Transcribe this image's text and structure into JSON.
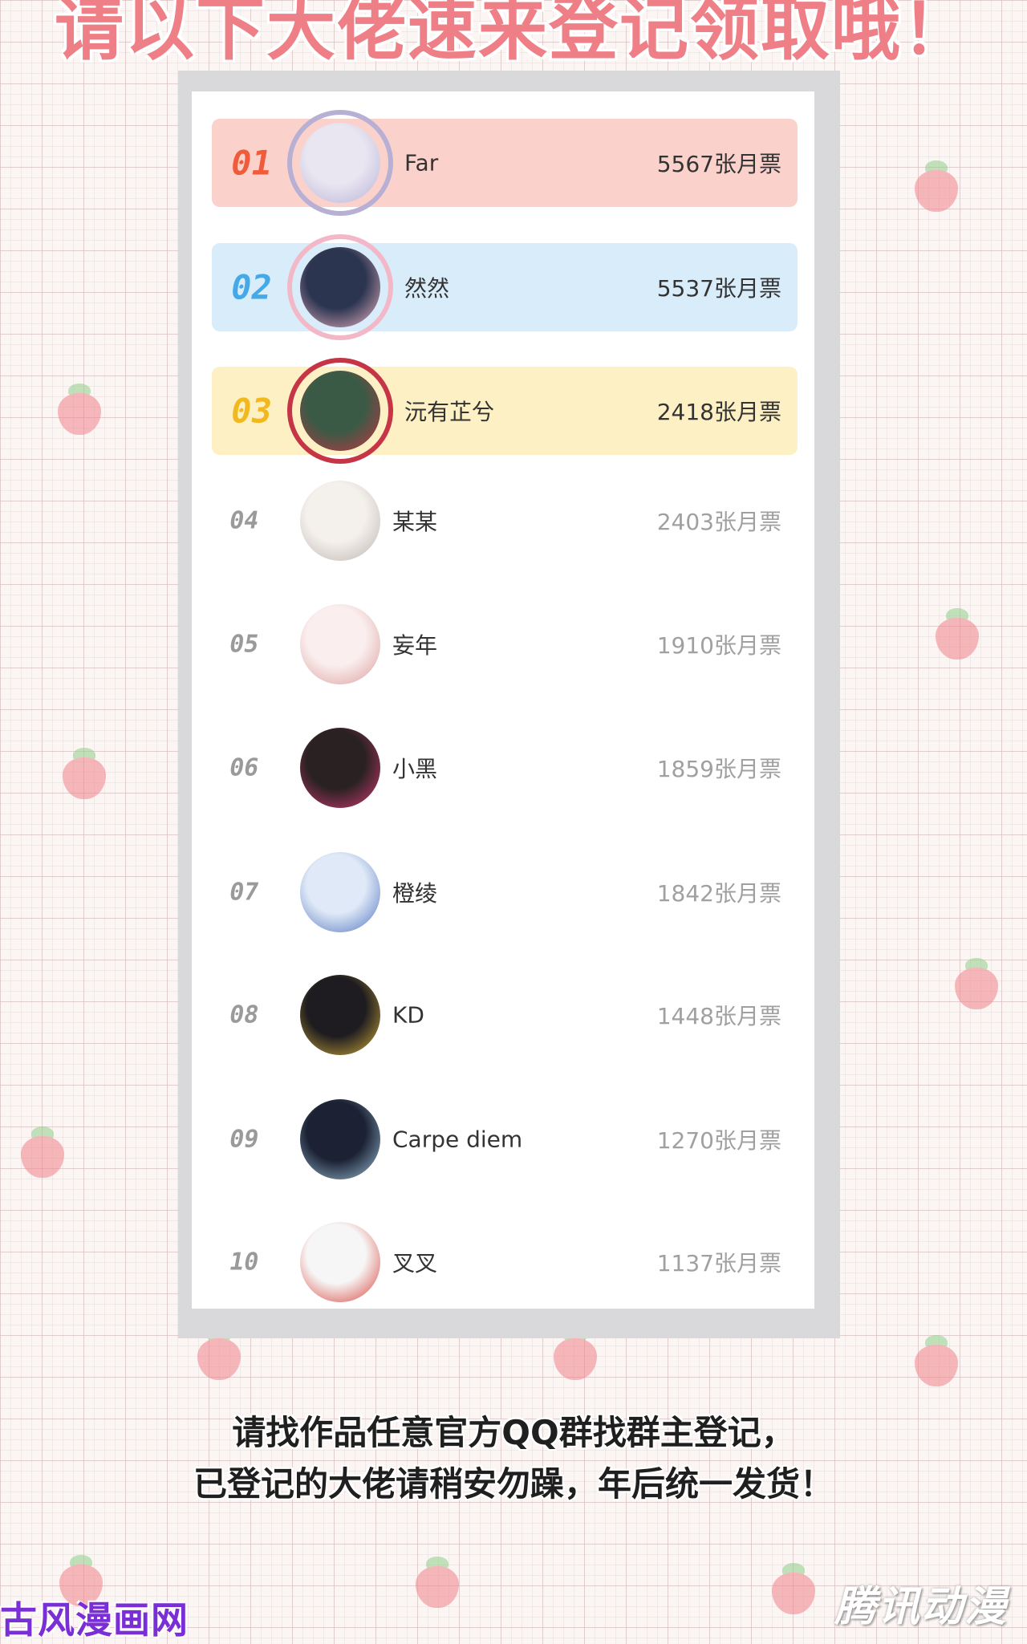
{
  "header": {
    "title": "请以下大佬速来登记领取哦！"
  },
  "ranking": [
    {
      "rank": "01",
      "name": "Far",
      "votes": "5567张月票",
      "style": "top",
      "rank_color": "#f05b3a",
      "avatar_colors": [
        "#e9e6f2",
        "#b7b0d4"
      ]
    },
    {
      "rank": "02",
      "name": "然然",
      "votes": "5537张月票",
      "style": "top",
      "rank_color": "#45a9e8",
      "avatar_colors": [
        "#2b3550",
        "#f3b8c8"
      ]
    },
    {
      "rank": "03",
      "name": "沅有芷兮",
      "votes": "2418张月票",
      "style": "top",
      "rank_color": "#f2b91e",
      "avatar_colors": [
        "#3b5a45",
        "#c53545"
      ]
    },
    {
      "rank": "04",
      "name": "某某",
      "votes": "2403张月票",
      "style": "plain",
      "avatar_colors": [
        "#f4f0ec",
        "#bbb3ad"
      ]
    },
    {
      "rank": "05",
      "name": "妄年",
      "votes": "1910张月票",
      "style": "plain",
      "avatar_colors": [
        "#fbeeee",
        "#d99a9a"
      ]
    },
    {
      "rank": "06",
      "name": "小黑",
      "votes": "1859张月票",
      "style": "plain",
      "avatar_colors": [
        "#2a2222",
        "#d83a78"
      ]
    },
    {
      "rank": "07",
      "name": "橙绫",
      "votes": "1842张月票",
      "style": "plain",
      "avatar_colors": [
        "#dfe9f7",
        "#4c6fbd"
      ]
    },
    {
      "rank": "08",
      "name": "KD",
      "votes": "1448张月票",
      "style": "plain",
      "avatar_colors": [
        "#1e1c20",
        "#d9b13a"
      ]
    },
    {
      "rank": "09",
      "name": "Carpe  diem",
      "votes": "1270张月票",
      "style": "plain",
      "avatar_colors": [
        "#1c2234",
        "#9fc4db"
      ]
    },
    {
      "rank": "10",
      "name": "叉叉",
      "votes": "1137张月票",
      "style": "plain",
      "avatar_colors": [
        "#f6f6f6",
        "#d63a30"
      ]
    }
  ],
  "footer": {
    "line1": "请找作品任意官方QQ群找群主登记，",
    "line2": "已登记的大佬请稍安勿躁，年后统一发货！"
  },
  "watermarks": {
    "left": "古风漫画网",
    "right": "腾讯动漫"
  }
}
